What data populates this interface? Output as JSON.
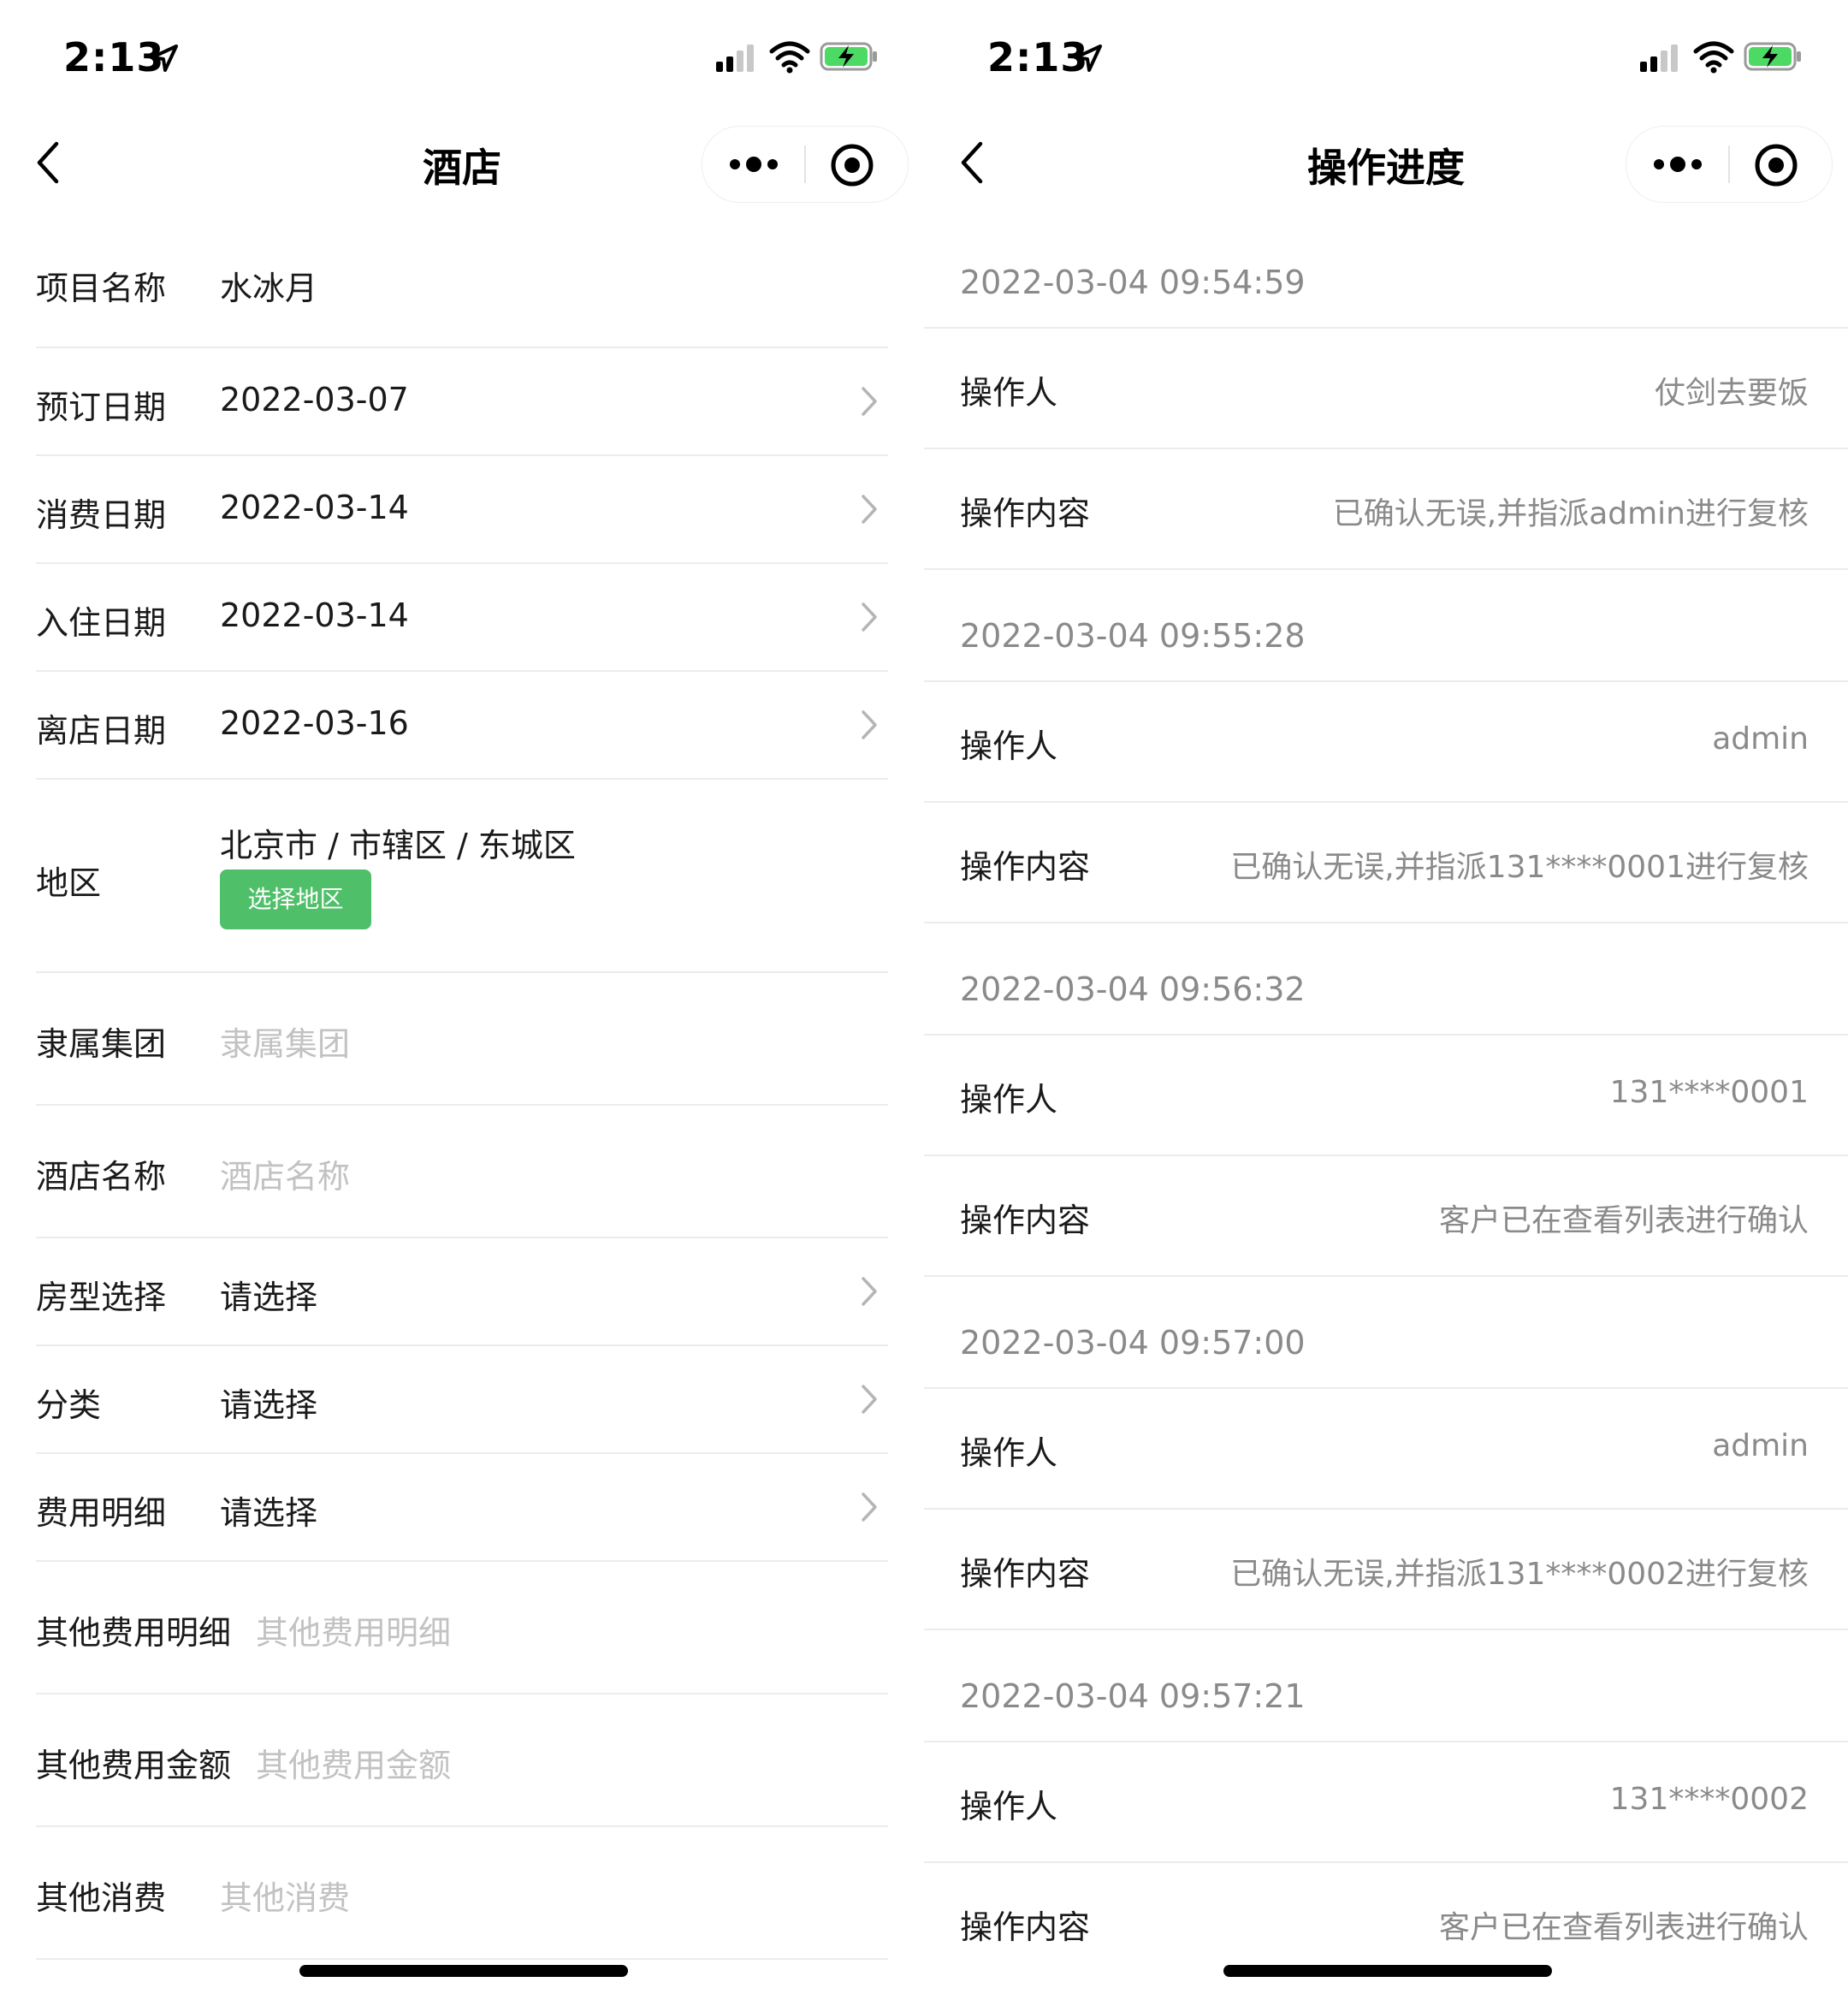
{
  "left": {
    "status": {
      "time": "2:13"
    },
    "nav": {
      "title": "酒店"
    },
    "form": {
      "project_name": {
        "label": "项目名称",
        "value": "水冰月"
      },
      "booking_date": {
        "label": "预订日期",
        "value": "2022-03-07"
      },
      "consume_date": {
        "label": "消费日期",
        "value": "2022-03-14"
      },
      "checkin_date": {
        "label": "入住日期",
        "value": "2022-03-14"
      },
      "checkout_date": {
        "label": "离店日期",
        "value": "2022-03-16"
      },
      "region": {
        "label": "地区",
        "value": "北京市 / 市辖区 / 东城区",
        "button_label": "选择地区"
      },
      "group": {
        "label": "隶属集团",
        "placeholder": "隶属集团"
      },
      "hotel_name": {
        "label": "酒店名称",
        "placeholder": "酒店名称"
      },
      "room_type": {
        "label": "房型选择",
        "value": "请选择"
      },
      "category": {
        "label": "分类",
        "value": "请选择"
      },
      "fee_detail": {
        "label": "费用明细",
        "value": "请选择"
      },
      "other_fee_detail": {
        "label": "其他费用明细",
        "placeholder": "其他费用明细"
      },
      "other_fee_amount": {
        "label": "其他费用金额",
        "placeholder": "其他费用金额"
      },
      "other_consume": {
        "label": "其他消费",
        "placeholder": "其他消费"
      }
    }
  },
  "right": {
    "status": {
      "time": "2:13"
    },
    "nav": {
      "title": "操作进度"
    },
    "operator_label": "操作人",
    "content_label": "操作内容",
    "logs": [
      {
        "time": "2022-03-04 09:54:59",
        "operator": "仗剑去要饭",
        "content": "已确认无误,并指派admin进行复核"
      },
      {
        "time": "2022-03-04 09:55:28",
        "operator": "admin",
        "content": "已确认无误,并指派131****0001进行复核"
      },
      {
        "time": "2022-03-04 09:56:32",
        "operator": "131****0001",
        "content": "客户已在查看列表进行确认"
      },
      {
        "time": "2022-03-04 09:57:00",
        "operator": "admin",
        "content": "已确认无误,并指派131****0002进行复核"
      },
      {
        "time": "2022-03-04 09:57:21",
        "operator": "131****0002",
        "content": "客户已在查看列表进行确认"
      }
    ]
  },
  "colors": {
    "accent_green": "#4fbf6a",
    "placeholder_gray": "#c2c2c2",
    "secondary_text": "#8a8a8a",
    "divider": "#ececec"
  },
  "icons": [
    "location-arrow-icon",
    "signal-icon",
    "wifi-icon",
    "battery-charging-icon",
    "back-chevron-icon",
    "more-dots-icon",
    "close-target-icon",
    "chevron-right-icon"
  ]
}
